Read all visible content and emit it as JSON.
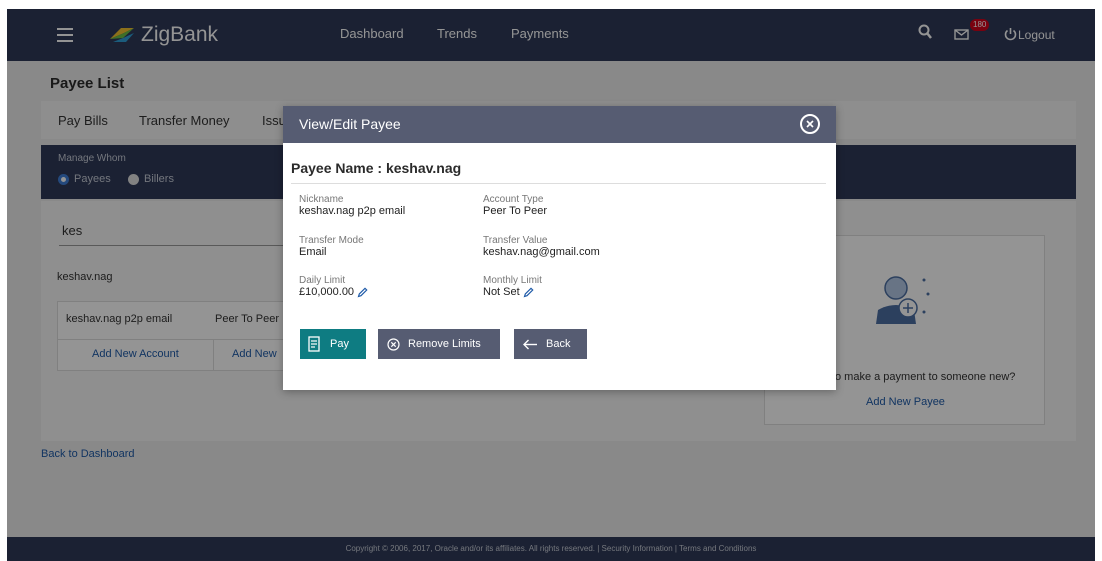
{
  "header": {
    "app_name": "ZigBank",
    "nav": [
      "Dashboard",
      "Trends",
      "Payments"
    ],
    "notification_count": "180",
    "logout_label": "Logout",
    "brand_color": "#2f3a58"
  },
  "page": {
    "title": "Payee List",
    "tabs": [
      "Pay Bills",
      "Transfer Money",
      "Issu"
    ],
    "manage_label": "Manage Whom",
    "radio_payees": "Payees",
    "radio_billers": "Billers",
    "search_value": "kes",
    "payee_name": "keshav.nag",
    "account_row": {
      "nickname": "keshav.nag p2p email",
      "type": "Peer To Peer"
    },
    "add_account": "Add New Account",
    "add_new_partial": "Add New",
    "new_payee_question": "o make a payment to someone new?",
    "add_new_payee": "Add New Payee",
    "back_dashboard": "Back to Dashboard",
    "footer": "Copyright © 2006, 2017, Oracle and/or its affiliates. All rights reserved. | Security Information | Terms and Conditions"
  },
  "modal": {
    "title": "View/Edit Payee",
    "heading": "Payee Name : keshav.nag",
    "fields": {
      "nickname": {
        "label": "Nickname",
        "value": "keshav.nag p2p email"
      },
      "account_type": {
        "label": "Account Type",
        "value": "Peer To Peer"
      },
      "transfer_mode": {
        "label": "Transfer Mode",
        "value": "Email"
      },
      "transfer_value": {
        "label": "Transfer Value",
        "value": "keshav.nag@gmail.com"
      },
      "daily_limit": {
        "label": "Daily Limit",
        "value": "£10,000.00"
      },
      "monthly_limit": {
        "label": "Monthly Limit",
        "value": "Not Set"
      }
    },
    "buttons": {
      "pay": "Pay",
      "remove_limits": "Remove Limits",
      "back": "Back"
    },
    "pay_color": "#0e7c82",
    "secondary_color": "#565c72"
  }
}
